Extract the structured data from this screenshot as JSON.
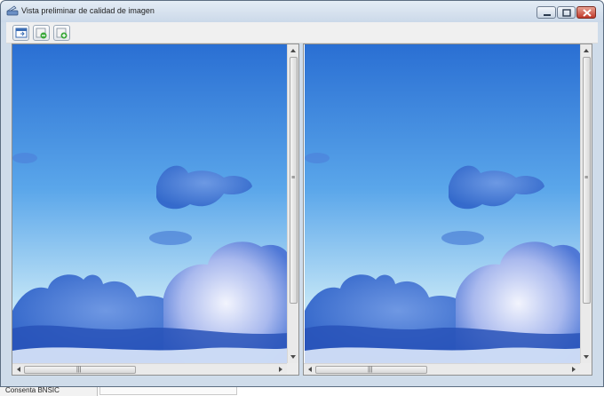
{
  "window": {
    "title": "Vista preliminar de calidad de imagen",
    "icon": "scanner-icon"
  },
  "title_buttons": [
    "minimize-icon",
    "maximize-icon",
    "close-icon"
  ],
  "toolbar": {
    "buttons": [
      {
        "icon": "fit-window-icon"
      },
      {
        "icon": "zoom-out-icon"
      },
      {
        "icon": "zoom-in-icon"
      }
    ]
  },
  "preview": {
    "left_image": "sky-with-clouds",
    "right_image": "sky-with-clouds",
    "sky_colors": {
      "top": "#2a6fd3",
      "mid": "#5aa6ea",
      "horizon": "#bfe3f6",
      "cloud": "#2f63c8",
      "cloud_light": "#e8eefc"
    }
  },
  "scrollbars": {
    "grip_glyph_v": "≡",
    "grip_glyph_h": "|||"
  },
  "status": {
    "text": "Consenta BNSIC"
  }
}
